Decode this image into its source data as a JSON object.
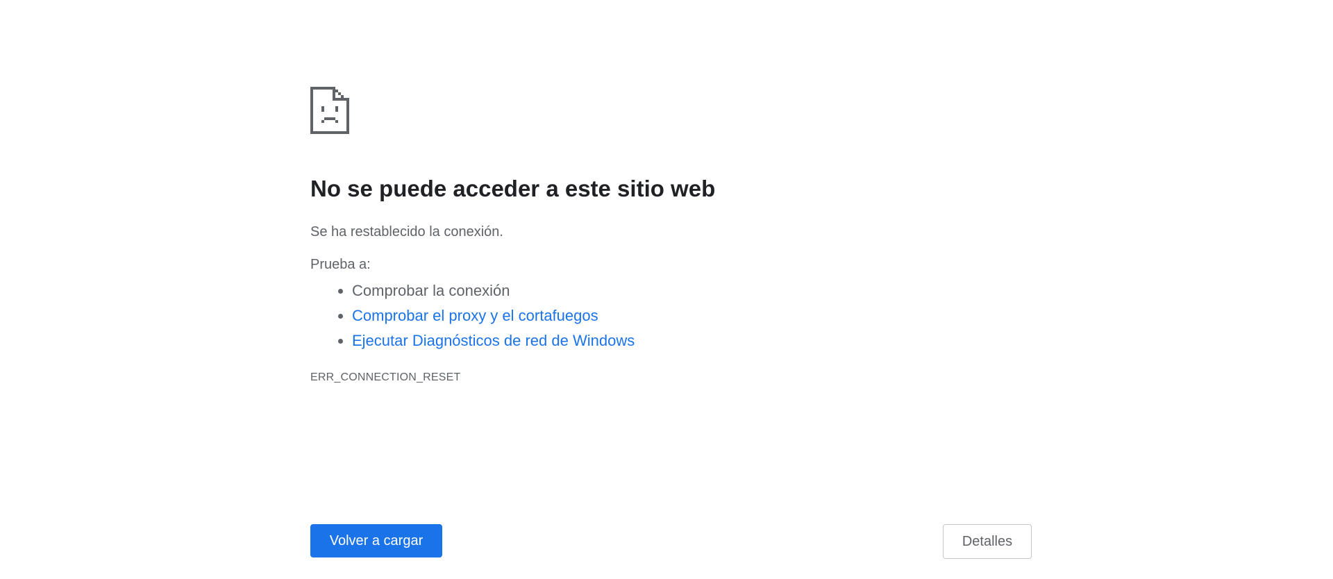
{
  "page": {
    "icon": "sad-document-icon",
    "title": "No se puede acceder a este sitio web",
    "description": "Se ha restablecido la conexión.",
    "suggestions_heading": "Prueba a:",
    "suggestions": [
      {
        "label": "Comprobar la conexión",
        "link": false
      },
      {
        "label": "Comprobar el proxy y el cortafuegos",
        "link": true
      },
      {
        "label": "Ejecutar Diagnósticos de red de Windows",
        "link": true
      }
    ],
    "error_code": "ERR_CONNECTION_RESET"
  },
  "buttons": {
    "reload_label": "Volver a cargar",
    "details_label": "Detalles"
  },
  "colors": {
    "primary": "#1a73e8",
    "text_primary": "#202124",
    "text_secondary": "#5f6368",
    "icon": "#5f6368"
  }
}
